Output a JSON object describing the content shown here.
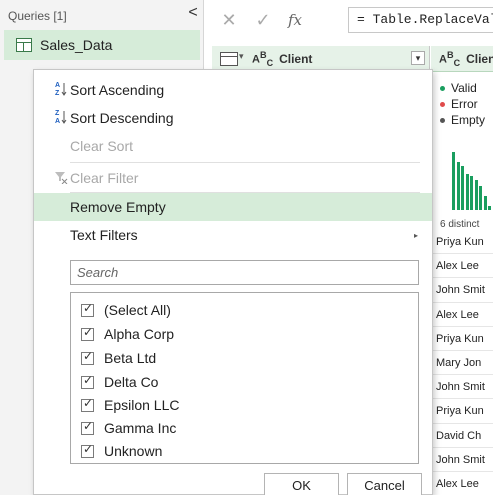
{
  "queries": {
    "header": "Queries [1]",
    "collapse_glyph": "<",
    "items": [
      {
        "name": "Sales_Data"
      }
    ]
  },
  "formula_bar": {
    "cancel_glyph": "✕",
    "accept_glyph": "✓",
    "fx_label": "fx",
    "formula": "= Table.ReplaceValue("
  },
  "columns": {
    "primary": {
      "type_label": "A",
      "type_sup": "B",
      "type_sub": "C",
      "name": "Client",
      "dropdown_glyph": "▾"
    },
    "secondary": {
      "type_label": "A",
      "type_sup": "B",
      "type_sub": "C",
      "name": "Clien"
    }
  },
  "quality": {
    "valid": "Valid",
    "error": "Error",
    "empty": "Empty",
    "colors": {
      "valid": "#1a9e5f",
      "error": "#e04b4b",
      "empty": "#555555"
    }
  },
  "histogram": [
    58,
    48,
    44,
    36,
    34,
    30,
    24,
    14,
    4
  ],
  "distinct": "6 distinct",
  "preview_rows": [
    "Priya Kun",
    "Alex Lee",
    "John Smit",
    "Alex Lee",
    "Priya Kun",
    "Mary Jon",
    "John Smit",
    "Priya Kun",
    "David Ch",
    "John Smit",
    "Alex Lee"
  ],
  "menu": {
    "sort_ascending": "Sort Ascending",
    "sort_descending": "Sort Descending",
    "clear_sort": "Clear Sort",
    "clear_filter": "Clear Filter",
    "remove_empty": "Remove Empty",
    "text_filters": "Text Filters",
    "submenu_glyph": "▸",
    "search_placeholder": "Search",
    "values": [
      "(Select All)",
      "Alpha Corp",
      "Beta Ltd",
      "Delta Co",
      "Epsilon LLC",
      "Gamma Inc",
      "Unknown"
    ],
    "ok": "OK",
    "cancel": "Cancel"
  }
}
